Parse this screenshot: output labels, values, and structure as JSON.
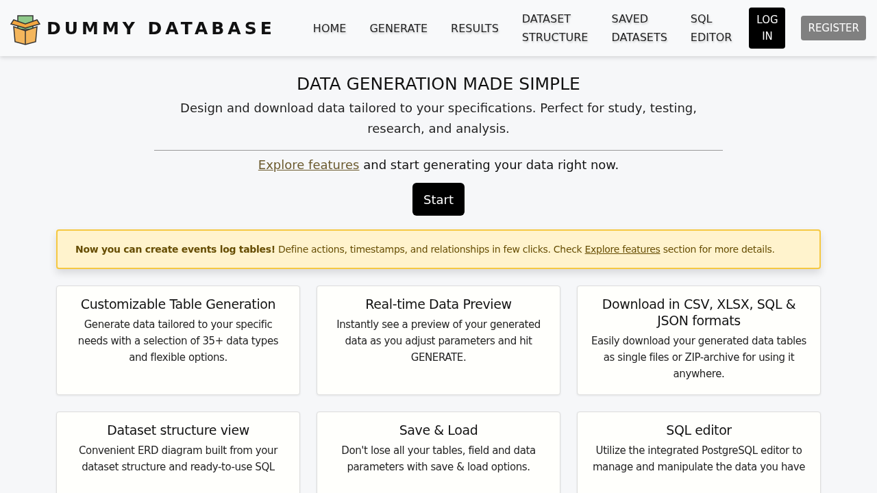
{
  "header": {
    "logo_text": "DUMMY DATABASE",
    "nav": [
      {
        "label": "HOME",
        "kind": "link"
      },
      {
        "label": "GENERATE",
        "kind": "link"
      },
      {
        "label": "RESULTS",
        "kind": "link"
      },
      {
        "label": "DATASET STRUCTURE",
        "kind": "link"
      },
      {
        "label": "SAVED DATASETS",
        "kind": "link"
      },
      {
        "label": "SQL EDITOR",
        "kind": "link"
      },
      {
        "label": "LOG IN",
        "kind": "primary"
      },
      {
        "label": "REGISTER",
        "kind": "secondary"
      }
    ]
  },
  "hero": {
    "title": "DATA GENERATION MADE SIMPLE",
    "subtitle": "Design and download data tailored to your specifications. Perfect for study, testing, research, and analysis.",
    "cta_link": "Explore features",
    "cta_text": "and start generating your data right now.",
    "button": "Start"
  },
  "notice": {
    "bold": "Now you can create events log tables!",
    "text": "Define actions, timestamps, and relationships in few clicks. Check",
    "link": "Explore features",
    "after": "section for more details."
  },
  "features": [
    {
      "title": "Customizable Table Generation",
      "text": "Generate data tailored to your specific needs with a selection of 35+ data types and flexible options."
    },
    {
      "title": "Real-time Data Preview",
      "text": "Instantly see a preview of your generated data as you adjust parameters and hit GENERATE."
    },
    {
      "title": "Download in CSV, XLSX, SQL & JSON formats",
      "text": "Easily download your generated data tables as single files or ZIP-archive for using it anywhere."
    },
    {
      "title": "Dataset structure view",
      "text": "Convenient ERD diagram built from your dataset structure and ready-to-use SQL"
    },
    {
      "title": "Save & Load",
      "text": "Don't lose all your tables, field and data parameters with save & load options."
    },
    {
      "title": "SQL editor",
      "text": "Utilize the integrated PostgreSQL editor to manage and manipulate the data you have"
    }
  ]
}
